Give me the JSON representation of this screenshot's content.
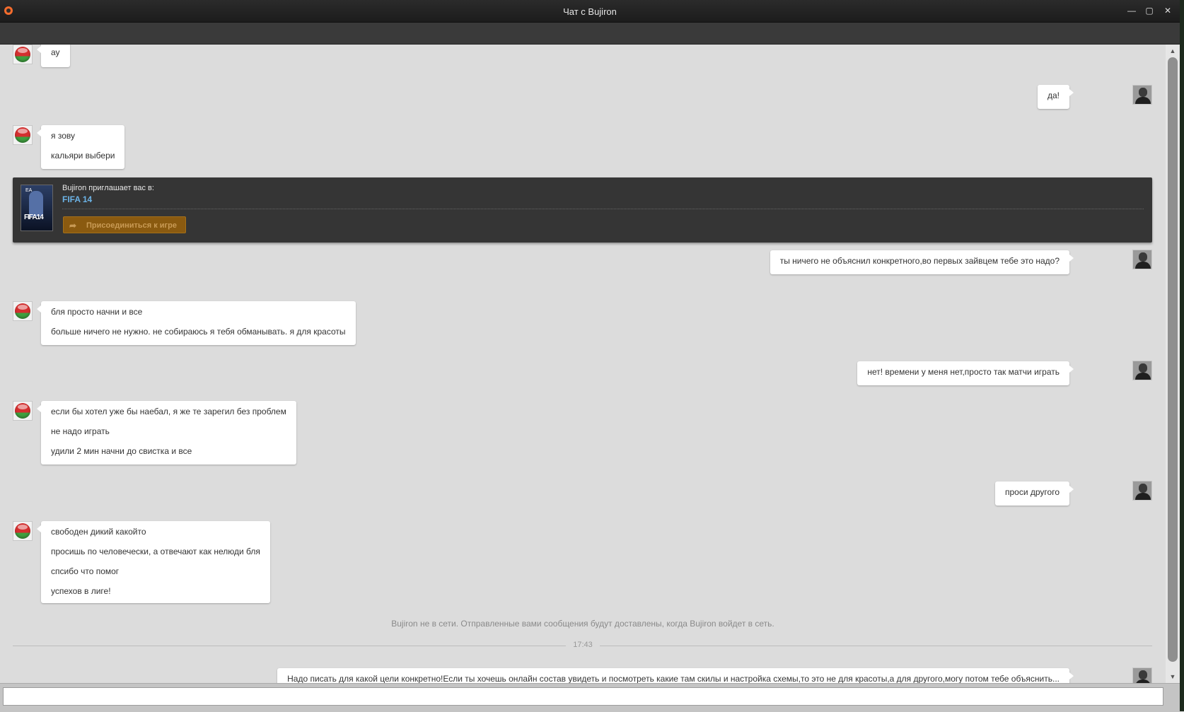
{
  "window": {
    "title": "Чат с Bujiron"
  },
  "messages": [
    {
      "side": "left",
      "lines": [
        "ау"
      ]
    },
    {
      "side": "right",
      "lines": [
        "да!"
      ]
    },
    {
      "side": "left",
      "lines": [
        "я зову",
        "кальяри выбери"
      ]
    },
    {
      "side": "right",
      "lines": [
        "ты ничего не объяснил конкретного,во первых зайвцем тебе это надо?"
      ]
    },
    {
      "side": "left",
      "lines": [
        "бля просто начни и все",
        "больше ничего не нужно. не собираюсь я тебя обманывать. я для красоты"
      ]
    },
    {
      "side": "right",
      "lines": [
        "нет! времени у меня нет,просто так матчи играть"
      ]
    },
    {
      "side": "left",
      "lines": [
        "если бы хотел уже бы наебал, я же те зарегил без проблем",
        "не надо играть",
        "удили 2 мин начни до свистка и все"
      ]
    },
    {
      "side": "right",
      "lines": [
        "проси другого"
      ]
    },
    {
      "side": "left",
      "lines": [
        "свободен дикий какойто",
        "просишь по человечески, а отвечают как нелюди бля",
        "спсибо что помог",
        "успехов в лиге!"
      ]
    },
    {
      "side": "right",
      "lines": [
        "Надо писать для какой цели конкретно!Если ты хочешь онлайн состав увидеть и посмотреть какие там скилы и настройка схемы,то это не для красоты,а для другого,могу потом тебе объяснить..."
      ]
    }
  ],
  "invite": {
    "text": "Bujiron приглашает вас в:",
    "game": "FIFA 14",
    "join_label": "Присоединиться к игре",
    "cover_brand": "EA",
    "cover_logo": "FIFA14"
  },
  "status_text": "Bujiron не в сети. Отправленные вами сообщения будут доставлены, когда Bujiron войдет в сеть.",
  "timestamp": "17:43",
  "input": {
    "value": "",
    "placeholder": ""
  },
  "colors": {
    "accent_link": "#6cb3e6",
    "join_button": "#8a5a10",
    "titlebar": "#1c1c1c"
  }
}
